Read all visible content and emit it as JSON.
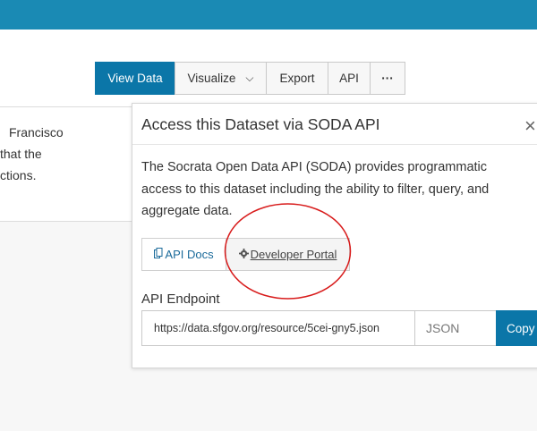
{
  "description_lines": [
    "Francisco",
    "that the",
    "ctions."
  ],
  "toolbar": {
    "view_data": "View Data",
    "visualize": "Visualize",
    "visualize_caret": "⌵",
    "export": "Export",
    "api": "API",
    "more": "···"
  },
  "popover": {
    "title": "Access this Dataset via SODA API",
    "close": "×",
    "body": "The Socrata Open Data API (SODA) provides programmatic access to this dataset including the ability to filter, query, and aggregate data.",
    "api_docs_label": "API Docs",
    "developer_portal_label": "Developer Portal",
    "endpoint_label": "API Endpoint",
    "endpoint_value": "https://data.sfgov.org/resource/5cei-gny5.json",
    "format": "JSON",
    "copy_label": "Copy"
  },
  "colors": {
    "topbar": "#1a8ab4",
    "primary": "#0b76a8",
    "annotation": "#d81b1b"
  }
}
